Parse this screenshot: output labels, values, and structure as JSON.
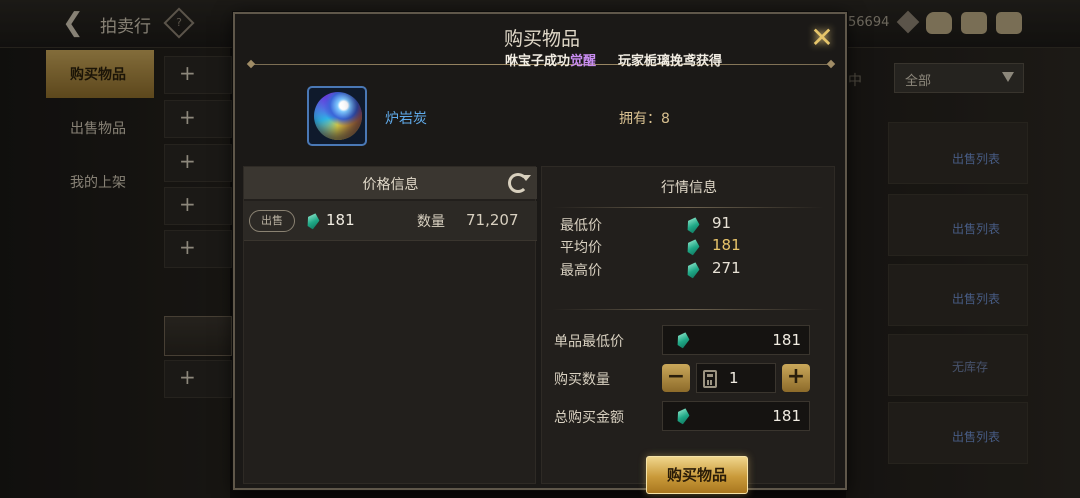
{
  "background": {
    "title": "拍卖行",
    "currency_partial": "56694",
    "side_tabs": [
      {
        "label": "购买物品",
        "active": true
      },
      {
        "label": "出售物品",
        "active": false
      },
      {
        "label": "我的上架",
        "active": false
      }
    ],
    "filter": {
      "selected": "全部"
    },
    "mid_partial": "中",
    "row_labels": [
      "出售列表",
      "出售列表",
      "出售列表",
      "无库存",
      "出售列表"
    ]
  },
  "modal": {
    "title": "购买物品",
    "ticker": {
      "part1": "咻宝子成功",
      "part1_highlight": "觉醒",
      "part2": "玩家栀璃挽鸢获得"
    },
    "item": {
      "name": "炉岩炭",
      "owned_label": "拥有：8"
    },
    "price_panel": {
      "header": "价格信息",
      "sell_badge": "出售",
      "price": "181",
      "qty_label": "数量",
      "qty_value": "71,207"
    },
    "market": {
      "title": "行情信息",
      "min_label": "最低价",
      "min_value": "91",
      "avg_label": "平均价",
      "avg_value": "181",
      "max_label": "最高价",
      "max_value": "271",
      "unit_price_label": "单品最低价",
      "unit_price_value": "181",
      "qty_label": "购买数量",
      "qty_value": "1",
      "total_label": "总购买金额",
      "total_value": "181",
      "buy_button": "购买物品"
    }
  },
  "colors": {
    "accent_gold": "#c9a75a",
    "highlight_purple": "#c88cf0",
    "avg_price": "#e8c46a",
    "item_name": "#5fa9e8"
  }
}
